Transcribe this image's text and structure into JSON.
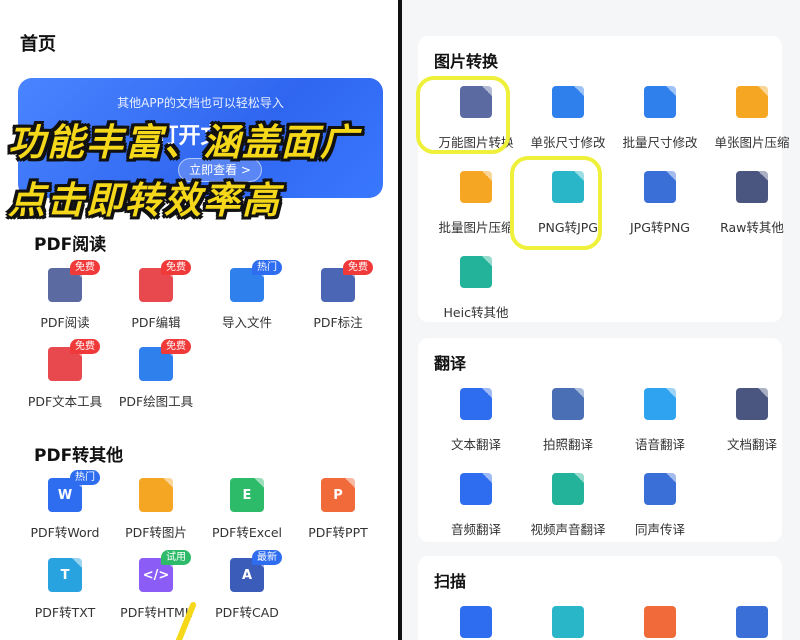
{
  "left": {
    "page_title": "首页",
    "banner": {
      "subtitle": "其他APP的文档也可以轻松导入",
      "title": "打开文件",
      "button": "立即查看 >"
    },
    "overlay": {
      "line1": "功能丰富、涵盖面广",
      "line2": "点击即转效率高"
    },
    "pdf_read": {
      "title": "PDF阅读",
      "items": [
        {
          "label": "PDF阅读",
          "badge": "免费",
          "icon": "book-icon",
          "color": "#5b6aa0"
        },
        {
          "label": "PDF编辑",
          "badge": "免费",
          "icon": "edit-doc-icon",
          "color": "#e8494f"
        },
        {
          "label": "导入文件",
          "badge": "热门",
          "icon": "import-icon",
          "color": "#2f80ed"
        },
        {
          "label": "PDF标注",
          "badge": "免费",
          "icon": "pin-icon",
          "color": "#4a66b5"
        },
        {
          "label": "PDF文本工具",
          "badge": "免费",
          "icon": "text-tool-icon",
          "color": "#e8494f"
        },
        {
          "label": "PDF绘图工具",
          "badge": "免费",
          "icon": "draw-icon",
          "color": "#2f80ed"
        }
      ]
    },
    "pdf_convert": {
      "title": "PDF转其他",
      "items": [
        {
          "label": "PDF转Word",
          "badge": "热门",
          "letter": "W",
          "icon": "word-icon",
          "color": "#2f6df0"
        },
        {
          "label": "PDF转图片",
          "badge": "",
          "letter": "",
          "icon": "image-icon",
          "color": "#f5a623"
        },
        {
          "label": "PDF转Excel",
          "badge": "",
          "letter": "E",
          "icon": "excel-icon",
          "color": "#2dbb6a"
        },
        {
          "label": "PDF转PPT",
          "badge": "",
          "letter": "P",
          "icon": "ppt-icon",
          "color": "#f06a3a"
        },
        {
          "label": "PDF转TXT",
          "badge": "",
          "letter": "T",
          "icon": "txt-icon",
          "color": "#29a3e0"
        },
        {
          "label": "PDF转HTML",
          "badge": "试用",
          "letter": "</>",
          "icon": "html-icon",
          "color": "#8b5cf6"
        },
        {
          "label": "PDF转CAD",
          "badge": "最新",
          "letter": "A",
          "icon": "cad-icon",
          "color": "#3b5cb8"
        }
      ]
    }
  },
  "right": {
    "image_convert": {
      "title": "图片转换",
      "items": [
        {
          "label": "万能图片转换",
          "icon": "image-convert-icon",
          "color": "#5b6aa0"
        },
        {
          "label": "单张尺寸修改",
          "icon": "resize-icon",
          "color": "#2f80ed"
        },
        {
          "label": "批量尺寸修改",
          "icon": "batch-resize-icon",
          "color": "#2f80ed"
        },
        {
          "label": "单张图片压缩",
          "icon": "compress-icon",
          "color": "#f5a623"
        },
        {
          "label": "批量图片压缩",
          "icon": "batch-compress-icon",
          "color": "#f5a623"
        },
        {
          "label": "PNG转JPG",
          "icon": "png-jpg-icon",
          "color": "#29b6c8"
        },
        {
          "label": "JPG转PNG",
          "icon": "jpg-png-icon",
          "color": "#3b6fd8"
        },
        {
          "label": "Raw转其他",
          "icon": "raw-icon",
          "color": "#4a5680"
        },
        {
          "label": "Heic转其他",
          "icon": "heic-icon",
          "color": "#22b39a"
        }
      ]
    },
    "translate": {
      "title": "翻译",
      "items": [
        {
          "label": "文本翻译",
          "icon": "text-translate-icon",
          "color": "#2f6df0"
        },
        {
          "label": "拍照翻译",
          "icon": "camera-icon",
          "color": "#4a6fb5"
        },
        {
          "label": "语音翻译",
          "icon": "voice-icon",
          "color": "#2fa3f0"
        },
        {
          "label": "文档翻译",
          "icon": "doc-translate-icon",
          "color": "#4a5680"
        },
        {
          "label": "音频翻译",
          "icon": "audio-icon",
          "color": "#2f6df0"
        },
        {
          "label": "视频声音翻译",
          "icon": "video-icon",
          "color": "#22b39a"
        },
        {
          "label": "同声传译",
          "icon": "simultaneous-icon",
          "color": "#3b6fd8"
        }
      ]
    },
    "scan": {
      "title": "扫描"
    }
  }
}
